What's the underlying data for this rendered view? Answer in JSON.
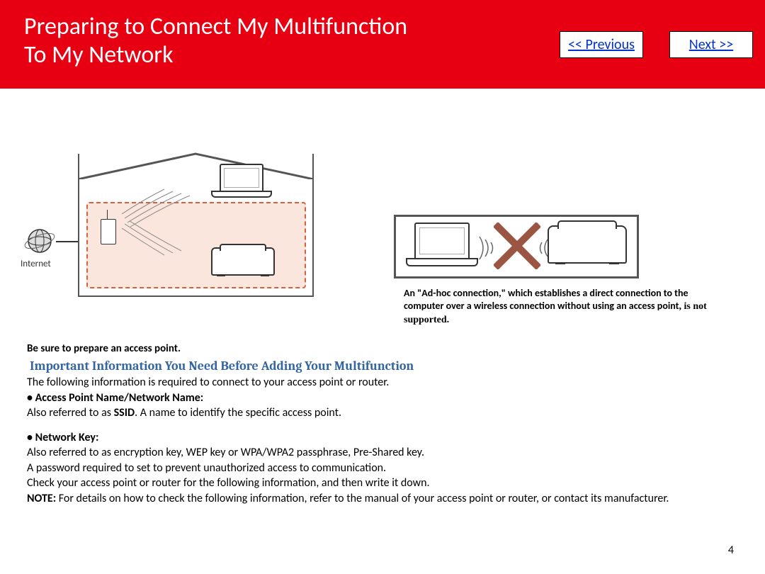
{
  "header": {
    "title_line1": "Preparing to Connect My Multifunction",
    "title_line2": "To My Network",
    "prev_label": "<< Previous",
    "next_label": "Next >>"
  },
  "left_diagram": {
    "internet_label": "Internet"
  },
  "adhoc": {
    "text_main": "An \"Ad-hoc connection,\" which establishes a direct connection to the computer over a wireless connection without using an access point",
    "text_tail": ", is not supported."
  },
  "body": {
    "prepare": "Be sure to prepare an access point.",
    "important_heading": "Important Information You Need Before Adding Your Multifunction",
    "intro": "The following information is required to connect to your access point or router.",
    "item1_label": "Access Point Name/Network Name:",
    "item1_desc_pre": "Also referred to as ",
    "item1_ssid": "SSID",
    "item1_desc_post": ". A name to identify the specific access point.",
    "item2_label": "Network Key:",
    "item2_line1": "Also referred to as encryption key, WEP key or WPA/WPA2 passphrase, Pre-Shared key.",
    "item2_line2": "A password required to set to prevent unauthorized access to communication.",
    "item2_line3": "Check your access point or router for the following information, and then write it down.",
    "note_label": "NOTE:",
    "note_text": "  For details on how to check the following information, refer to the manual of your access point or router, or contact its manufacturer."
  },
  "page_number": "4"
}
